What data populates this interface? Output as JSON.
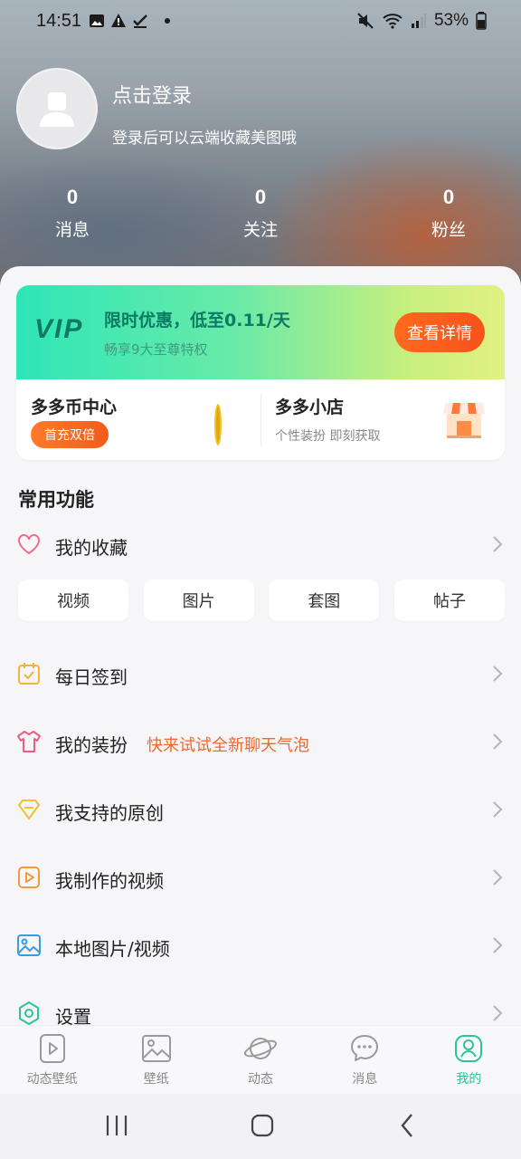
{
  "status_bar": {
    "time": "14:51",
    "battery": "53%"
  },
  "profile": {
    "login_title": "点击登录",
    "login_subtitle": "登录后可以云端收藏美图哦"
  },
  "stats": [
    {
      "count": "0",
      "label": "消息"
    },
    {
      "count": "0",
      "label": "关注"
    },
    {
      "count": "0",
      "label": "粉丝"
    }
  ],
  "vip": {
    "logo": "VIP",
    "title": "限时优惠，低至0.11/天",
    "subtitle": "畅享9大至尊特权",
    "button": "查看详情"
  },
  "coin_center": {
    "title": "多多币中心",
    "badge": "首充双倍"
  },
  "shop": {
    "title": "多多小店",
    "subtitle": "个性装扮 即刻获取"
  },
  "section_title": "常用功能",
  "favorites": {
    "label": "我的收藏",
    "chips": [
      "视频",
      "图片",
      "套图",
      "帖子"
    ]
  },
  "menu": [
    {
      "label": "每日签到",
      "icon": "calendar-check-icon"
    },
    {
      "label": "我的装扮",
      "icon": "shirt-icon",
      "promo": "快来试试全新聊天气泡"
    },
    {
      "label": "我支持的原创",
      "icon": "diamond-icon"
    },
    {
      "label": "我制作的视频",
      "icon": "video-play-icon"
    },
    {
      "label": "本地图片/视频",
      "icon": "image-icon"
    },
    {
      "label": "设置",
      "icon": "gear-icon"
    }
  ],
  "bottom_nav": [
    {
      "label": "动态壁纸",
      "icon": "live-wallpaper-icon"
    },
    {
      "label": "壁纸",
      "icon": "wallpaper-icon"
    },
    {
      "label": "动态",
      "icon": "planet-icon"
    },
    {
      "label": "消息",
      "icon": "chat-bubble-icon"
    },
    {
      "label": "我的",
      "icon": "profile-icon",
      "active": true
    }
  ],
  "colors": {
    "accent": "#2bc49b",
    "orange": "#f25c1a",
    "promo": "#f0672a"
  }
}
